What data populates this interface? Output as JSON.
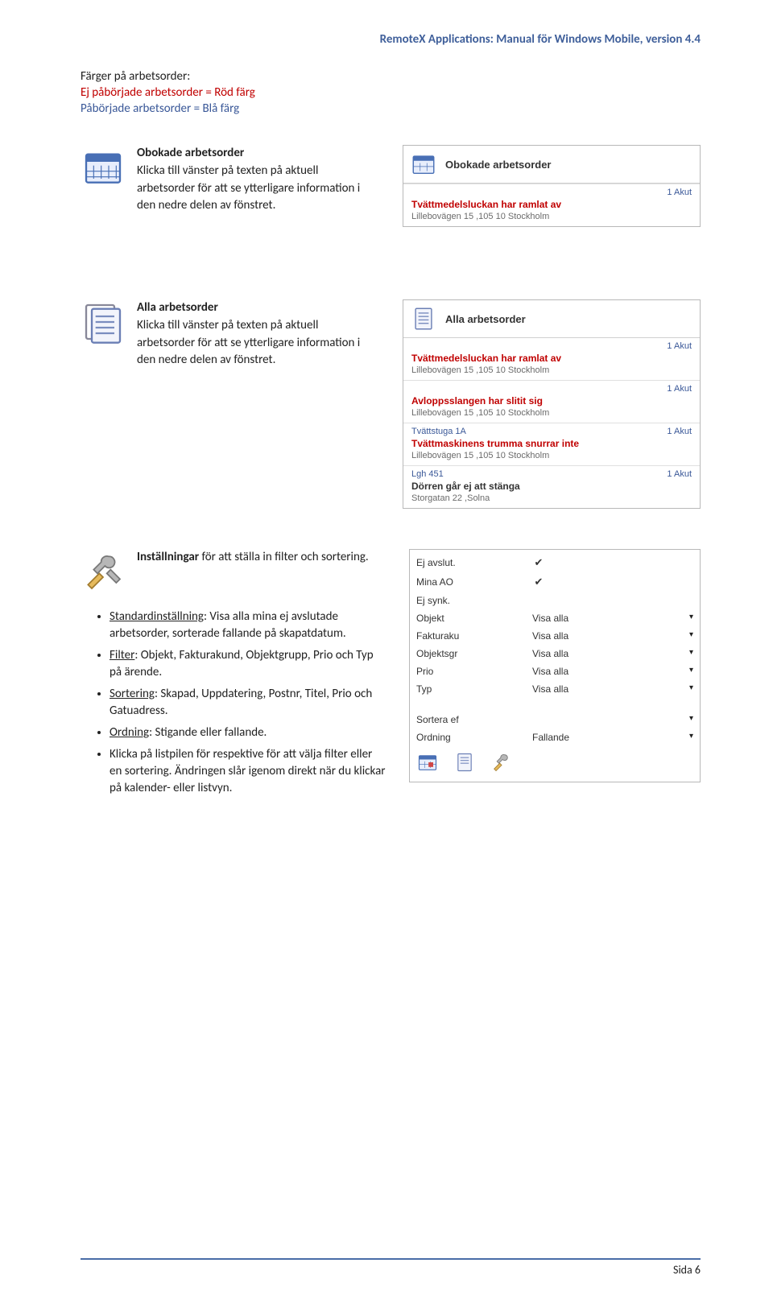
{
  "doc_header": "RemoteX Applications: Manual för Windows Mobile, version 4.4",
  "intro": {
    "heading": "Färger på arbetsorder:",
    "red_line": "Ej påbörjade arbetsorder = Röd färg",
    "blue_line": "Påbörjade arbetsorder = Blå färg"
  },
  "block1": {
    "title": "Obokade arbetsorder",
    "desc": "Klicka till vänster på texten på aktuell arbetsorder för att se ytterligare information i den nedre delen av fönstret.",
    "shot": {
      "head": "Obokade arbetsorder",
      "rows": [
        {
          "meta_left": "",
          "meta_right": "1 Akut",
          "title": "Tvättmedelsluckan har ramlat av",
          "title_class": "title-red",
          "sub": "Lillebovägen 15 ,105 10 Stockholm"
        }
      ]
    }
  },
  "block2": {
    "title": "Alla arbetsorder",
    "desc": "Klicka till vänster på texten på aktuell arbetsorder för att se ytterligare information i den nedre delen av fönstret.",
    "shot": {
      "head": "Alla arbetsorder",
      "rows": [
        {
          "meta_left": "",
          "meta_right": "1 Akut",
          "title": "Tvättmedelsluckan har ramlat av",
          "title_class": "title-red",
          "sub": "Lillebovägen 15 ,105 10 Stockholm"
        },
        {
          "meta_left": "",
          "meta_right": "1 Akut",
          "title": "Avloppsslangen har slitit sig",
          "title_class": "title-red",
          "sub": "Lillebovägen 15 ,105 10 Stockholm"
        },
        {
          "meta_left": "Tvättstuga 1A",
          "meta_right": "1 Akut",
          "title": "Tvättmaskinens trumma snurrar inte",
          "title_class": "title-red",
          "sub": "Lillebovägen 15 ,105 10 Stockholm"
        },
        {
          "meta_left": "Lgh 451",
          "meta_right": "1 Akut",
          "title": "Dörren går ej att stänga",
          "title_class": "title-black",
          "sub": "Storgatan 22 ,Solna"
        }
      ]
    }
  },
  "settings": {
    "heading_bold": "Inställningar",
    "heading_rest": " för att ställa in filter och sortering.",
    "bullets": [
      {
        "label": "Standardinställning",
        "rest": ": Visa alla mina ej avslutade arbetsorder, sorterade fallande på skapatdatum."
      },
      {
        "label": "Filter",
        "rest": ": Objekt, Fakturakund, Objektgrupp, Prio och Typ på ärende."
      },
      {
        "label": "Sortering",
        "rest": ": Skapad, Uppdatering, Postnr, Titel, Prio och Gatuadress."
      },
      {
        "label": "Ordning",
        "rest": ": Stigande eller fallande."
      },
      {
        "label": "",
        "rest": "Klicka på listpilen för respektive för att välja filter eller en sortering. Ändringen slår igenom direkt när du klickar på kalender- eller listvyn."
      }
    ],
    "shot": {
      "rows_check": [
        {
          "label": "Ej avslut.",
          "checked": true
        },
        {
          "label": "Mina AO",
          "checked": true
        },
        {
          "label": "Ej synk.",
          "checked": false
        }
      ],
      "rows_dd": [
        {
          "label": "Objekt",
          "value": "Visa alla"
        },
        {
          "label": "Fakturaku",
          "value": "Visa alla"
        },
        {
          "label": "Objektsgr",
          "value": "Visa alla"
        },
        {
          "label": "Prio",
          "value": "Visa alla"
        },
        {
          "label": "Typ",
          "value": "Visa alla"
        }
      ],
      "rows_dd2": [
        {
          "label": "Sortera ef",
          "value": ""
        },
        {
          "label": "Ordning",
          "value": "Fallande"
        }
      ]
    }
  },
  "footer": "Sida 6"
}
